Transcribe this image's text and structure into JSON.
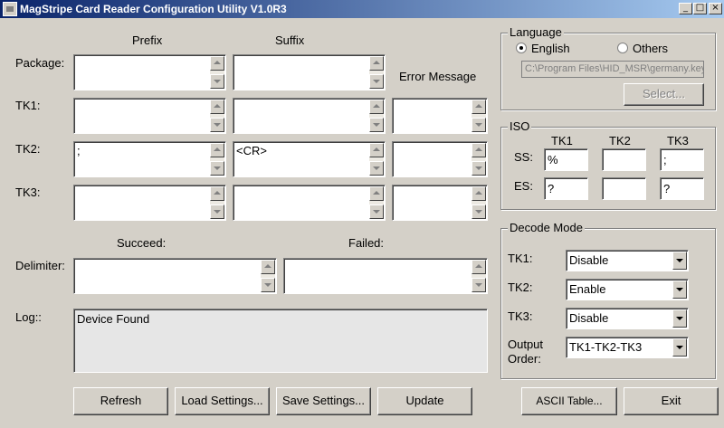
{
  "window": {
    "title": "MagStripe Card Reader Configuration Utility V1.0R3",
    "controls": {
      "minimize": "_",
      "maximize": "□",
      "close": "×"
    }
  },
  "columns": {
    "prefix": "Prefix",
    "suffix": "Suffix",
    "error_message": "Error Message"
  },
  "rows": {
    "package": "Package:",
    "tk1": "TK1:",
    "tk2": "TK2:",
    "tk3": "TK3:"
  },
  "fields": {
    "package_prefix": "",
    "package_suffix": "",
    "tk1_prefix": "",
    "tk1_suffix": "",
    "tk1_error": "",
    "tk2_prefix": ";",
    "tk2_suffix": "<CR>",
    "tk2_error": "",
    "tk3_prefix": "",
    "tk3_suffix": "",
    "tk3_error": ""
  },
  "delimiter": {
    "label": "Delimiter:",
    "succeed_label": "Succeed:",
    "failed_label": "Failed:",
    "succeed_value": "",
    "failed_value": ""
  },
  "log": {
    "label": "Log::",
    "text": "Device Found"
  },
  "buttons": {
    "refresh": "Refresh",
    "load": "Load Settings...",
    "save": "Save Settings...",
    "update": "Update",
    "ascii": "ASCII Table...",
    "exit": "Exit"
  },
  "language": {
    "legend": "Language",
    "english": "English",
    "others": "Others",
    "selected": "English",
    "path": "C:\\Program Files\\HID_MSR\\germany.key",
    "select_button": "Select..."
  },
  "iso": {
    "legend": "ISO",
    "col_tk1": "TK1",
    "col_tk2": "TK2",
    "col_tk3": "TK3",
    "ss_label": "SS:",
    "es_label": "ES:",
    "ss_tk1": "%",
    "ss_tk2": "",
    "ss_tk3": ";",
    "es_tk1": "?",
    "es_tk2": "",
    "es_tk3": "?"
  },
  "decode": {
    "legend": "Decode Mode",
    "tk1_label": "TK1:",
    "tk2_label": "TK2:",
    "tk3_label": "TK3:",
    "order_label_1": "Output",
    "order_label_2": "Order:",
    "tk1_value": "Disable",
    "tk2_value": "Enable",
    "tk3_value": "Disable",
    "order_value": "TK1-TK2-TK3"
  }
}
